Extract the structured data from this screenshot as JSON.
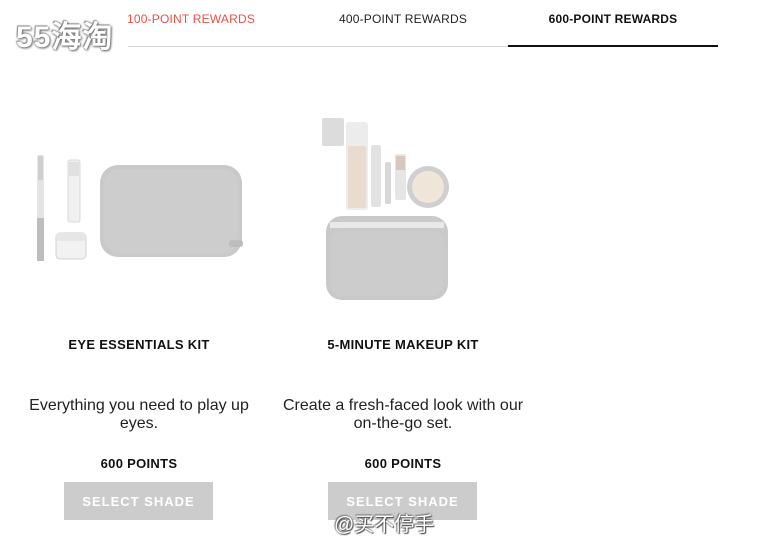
{
  "tabs": [
    {
      "label": "100-POINT REWARDS"
    },
    {
      "label": "400-POINT REWARDS"
    },
    {
      "label": "600-POINT REWARDS"
    }
  ],
  "products": [
    {
      "title": "EYE ESSENTIALS KIT",
      "description": "Everything you need to play up eyes.",
      "points": "600 POINTS",
      "button_label": "SELECT SHADE"
    },
    {
      "title": "5-MINUTE MAKEUP KIT",
      "description": "Create a fresh-faced look with our on-the-go set.",
      "points": "600 POINTS",
      "button_label": "SELECT SHADE"
    }
  ],
  "watermarks": {
    "top": "55海淘",
    "bottom": "@买不停手"
  }
}
